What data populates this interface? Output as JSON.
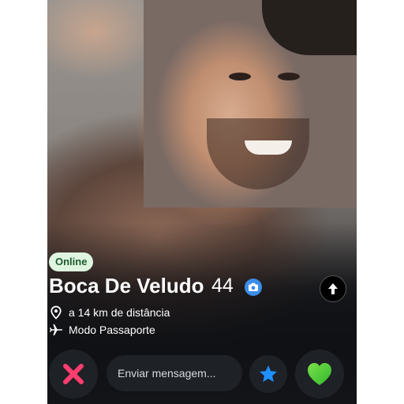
{
  "profile": {
    "status_badge": "Online",
    "name": "Boca De Veludo",
    "age": "44",
    "distance": "a 14 km de distância",
    "mode": "Modo Passaporte"
  },
  "actions": {
    "message_placeholder": "Enviar mensagem..."
  },
  "icons": {
    "verified": "camera-icon",
    "expand": "arrow-up-icon",
    "distance": "location-pin-icon",
    "mode": "airplane-icon",
    "dislike": "x-icon",
    "superlike": "star-icon",
    "like": "heart-icon"
  },
  "colors": {
    "badge_bg": "#dff5e0",
    "badge_text": "#1d5a2e",
    "verified": "#3b8eea",
    "dislike": "#ff3d6e",
    "superlike": "#1f8fff",
    "like": "#4cd137",
    "background": "#121418"
  }
}
